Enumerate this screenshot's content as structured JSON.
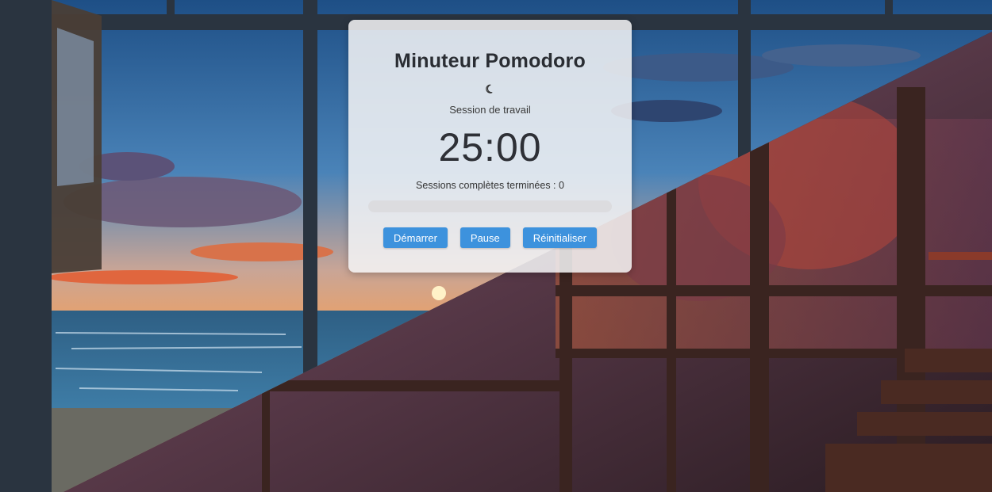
{
  "app": {
    "title": "Minuteur Pomodoro",
    "theme_icon": "moon-icon",
    "session_label": "Session de travail",
    "timer_display": "25:00",
    "sessions_completed_text": "Sessions complètes terminées : 0",
    "progress_fraction": 0
  },
  "buttons": {
    "start": "Démarrer",
    "pause": "Pause",
    "reset": "Réinitialiser"
  },
  "colors": {
    "accent": "#3d92dd",
    "card_bg": "#f4f4f6",
    "progress_track": "#dcdcdf"
  }
}
